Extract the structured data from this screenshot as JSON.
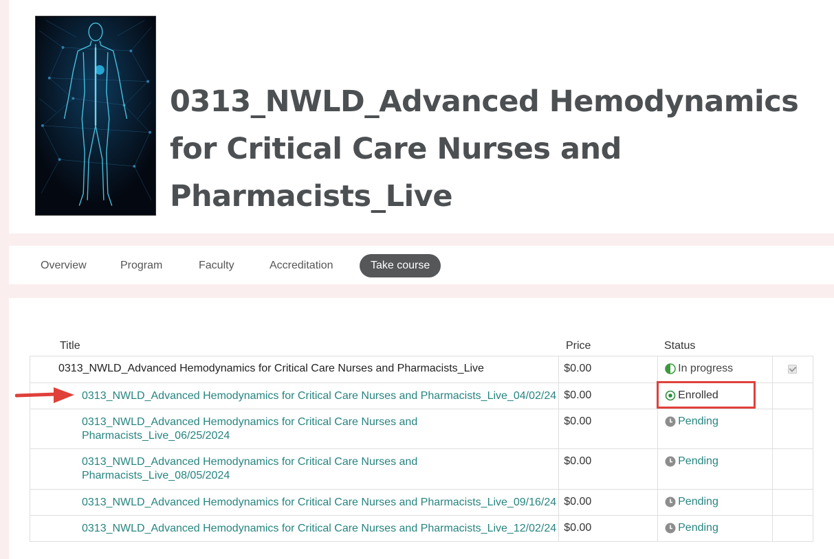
{
  "course": {
    "title": "0313_NWLD_Advanced Hemodynamics for Critical Care Nurses and Pharmacists_Live",
    "image_icon": "human-circulatory-system-image"
  },
  "tabs": [
    {
      "label": "Overview",
      "active": false
    },
    {
      "label": "Program",
      "active": false
    },
    {
      "label": "Faculty",
      "active": false
    },
    {
      "label": "Accreditation",
      "active": false
    },
    {
      "label": "Take course",
      "active": true
    }
  ],
  "table": {
    "headers": {
      "title": "Title",
      "price": "Price",
      "status": "Status"
    },
    "rows": [
      {
        "title": "0313_NWLD_Advanced Hemodynamics for Critical Care Nurses and Pharmacists_Live",
        "price": "$0.00",
        "status": "In progress",
        "status_icon": "half-circle-icon",
        "checked": true,
        "is_link": false
      },
      {
        "title": "0313_NWLD_Advanced Hemodynamics for Critical Care Nurses and Pharmacists_Live_04/02/24",
        "price": "$0.00",
        "status": "Enrolled",
        "status_icon": "radio-dot-icon",
        "checked": false,
        "is_link": true
      },
      {
        "title_line1": "0313_NWLD_Advanced Hemodynamics for Critical Care Nurses and",
        "title_line2": "Pharmacists_Live_06/25/2024",
        "price": "$0.00",
        "status": "Pending",
        "status_icon": "clock-icon",
        "checked": false,
        "is_link": true
      },
      {
        "title_line1": "0313_NWLD_Advanced Hemodynamics for Critical Care Nurses and",
        "title_line2": "Pharmacists_Live_08/05/2024",
        "price": "$0.00",
        "status": "Pending",
        "status_icon": "clock-icon",
        "checked": false,
        "is_link": true
      },
      {
        "title": "0313_NWLD_Advanced Hemodynamics for Critical Care Nurses and Pharmacists_Live_09/16/24",
        "price": "$0.00",
        "status": "Pending",
        "status_icon": "clock-icon",
        "checked": false,
        "is_link": true
      },
      {
        "title": "0313_NWLD_Advanced Hemodynamics for Critical Care Nurses and Pharmacists_Live_12/02/24",
        "price": "$0.00",
        "status": "Pending",
        "status_icon": "clock-icon",
        "checked": false,
        "is_link": true
      }
    ]
  },
  "colors": {
    "link": "#26847f",
    "accent_annotation": "#e0403a",
    "tab_active_bg": "#555759",
    "title_text": "#4d5052",
    "page_bg": "#fbeeee"
  }
}
